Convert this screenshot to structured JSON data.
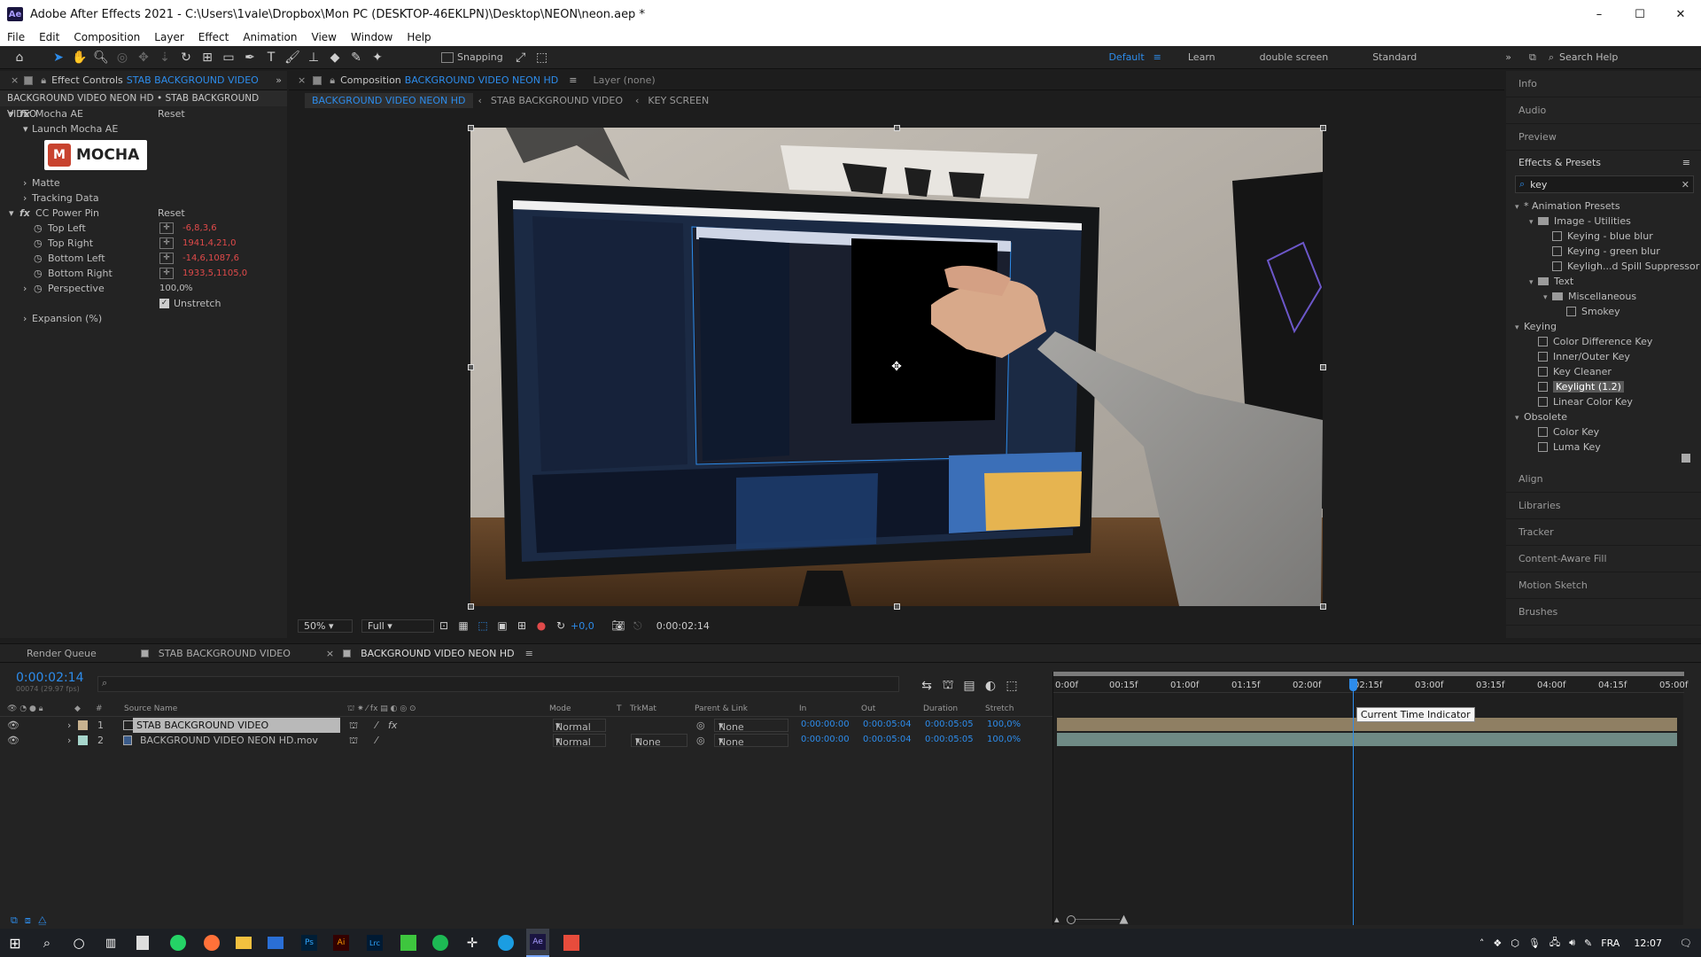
{
  "window": {
    "title": "Adobe After Effects 2021 - C:\\Users\\1vale\\Dropbox\\Mon PC (DESKTOP-46EKLPN)\\Desktop\\NEON\\neon.aep *",
    "app_icon": "Ae",
    "min": "–",
    "max": "☐",
    "close": "✕"
  },
  "menu": [
    "File",
    "Edit",
    "Composition",
    "Layer",
    "Effect",
    "Animation",
    "View",
    "Window",
    "Help"
  ],
  "toolbar": {
    "snapping": "Snapping",
    "workspaces": [
      "Default",
      "Learn",
      "double screen",
      "Standard"
    ],
    "search_placeholder": "Search Help"
  },
  "effect_controls": {
    "tab_prefix": "Effect Controls",
    "tab_layer": "STAB BACKGROUND VIDEO",
    "breadcrumb": "BACKGROUND VIDEO NEON HD • STAB BACKGROUND VIDEO",
    "mocha": {
      "name": "Mocha AE",
      "reset": "Reset",
      "launch": "Launch Mocha AE",
      "logo": "MOCHA",
      "matte": "Matte",
      "tracking": "Tracking Data"
    },
    "power_pin": {
      "name": "CC Power Pin",
      "reset": "Reset",
      "params": [
        {
          "label": "Top Left",
          "value": "-6,8,3,6"
        },
        {
          "label": "Top Right",
          "value": "1941,4,21,0"
        },
        {
          "label": "Bottom Left",
          "value": "-14,6,1087,6"
        },
        {
          "label": "Bottom Right",
          "value": "1933,5,1105,0"
        }
      ],
      "perspective_label": "Perspective",
      "perspective_value": "100,0",
      "perspective_unit": "%",
      "unstretch": "Unstretch",
      "expansion": "Expansion (%)"
    }
  },
  "composition": {
    "tab_prefix": "Composition",
    "tab_name": "BACKGROUND VIDEO NEON HD",
    "layer_label": "Layer (none)",
    "crumbs": [
      "BACKGROUND VIDEO NEON HD",
      "STAB BACKGROUND VIDEO",
      "KEY SCREEN"
    ],
    "zoom": "50%",
    "resolution": "Full",
    "exposure": "+0,0",
    "timecode": "0:00:02:14"
  },
  "right_panel": {
    "top_items": [
      "Info",
      "Audio",
      "Preview"
    ],
    "effects_title": "Effects & Presets",
    "search_value": "key",
    "tree": [
      {
        "label": "* Animation Presets",
        "level": 0,
        "type": "group"
      },
      {
        "label": "Image - Utilities",
        "level": 1,
        "type": "folder"
      },
      {
        "label": "Keying - blue blur",
        "level": 2,
        "type": "preset"
      },
      {
        "label": "Keying - green blur",
        "level": 2,
        "type": "preset"
      },
      {
        "label": "Keyligh...d Spill Suppressor",
        "level": 2,
        "type": "preset"
      },
      {
        "label": "Text",
        "level": 1,
        "type": "folder"
      },
      {
        "label": "Miscellaneous",
        "level": 2,
        "type": "folder"
      },
      {
        "label": "Smokey",
        "level": 3,
        "type": "preset"
      },
      {
        "label": "Keying",
        "level": 0,
        "type": "group"
      },
      {
        "label": "Color Difference Key",
        "level": 1,
        "type": "effect"
      },
      {
        "label": "Inner/Outer Key",
        "level": 1,
        "type": "effect"
      },
      {
        "label": "Key Cleaner",
        "level": 1,
        "type": "effect"
      },
      {
        "label": "Keylight (1.2)",
        "level": 1,
        "type": "effect",
        "selected": true
      },
      {
        "label": "Linear Color Key",
        "level": 1,
        "type": "effect"
      },
      {
        "label": "Obsolete",
        "level": 0,
        "type": "group"
      },
      {
        "label": "Color Key",
        "level": 1,
        "type": "effect"
      },
      {
        "label": "Luma Key",
        "level": 1,
        "type": "effect"
      }
    ],
    "bottom_items": [
      "Align",
      "Libraries",
      "Tracker",
      "Content-Aware Fill",
      "Motion Sketch",
      "Brushes"
    ]
  },
  "timeline": {
    "tabs": [
      "Render Queue",
      "STAB BACKGROUND VIDEO",
      "BACKGROUND VIDEO NEON HD"
    ],
    "timecode": "0:00:02:14",
    "fps": "00074 (29.97 fps)",
    "columns": [
      "#",
      "Source Name",
      "Mode",
      "T",
      "TrkMat",
      "Parent & Link",
      "In",
      "Out",
      "Duration",
      "Stretch"
    ],
    "layers": [
      {
        "num": "1",
        "name": "STAB BACKGROUND VIDEO",
        "mode": "Normal",
        "trkmat": "",
        "parent": "None",
        "in": "0:00:00:00",
        "out": "0:00:05:04",
        "duration": "0:00:05:05",
        "stretch": "100,0%",
        "label": "#c8b28f"
      },
      {
        "num": "2",
        "name": "BACKGROUND VIDEO NEON HD.mov",
        "mode": "Normal",
        "trkmat": "None",
        "parent": "None",
        "in": "0:00:00:00",
        "out": "0:00:05:04",
        "duration": "0:00:05:05",
        "stretch": "100,0%",
        "label": "#a7d6cc"
      }
    ],
    "ruler": [
      "0:00f",
      "00:15f",
      "01:00f",
      "01:15f",
      "02:00f",
      "02:15f",
      "03:00f",
      "03:15f",
      "04:00f",
      "04:15f",
      "05:00f"
    ],
    "playhead_fraction": 0.478,
    "tooltip": "Current Time Indicator"
  },
  "taskbar": {
    "lang": "FRA",
    "clock": "12:07"
  },
  "colors": {
    "accent": "#2d8ceb",
    "error": "#e04a4a",
    "panel": "#232323"
  }
}
